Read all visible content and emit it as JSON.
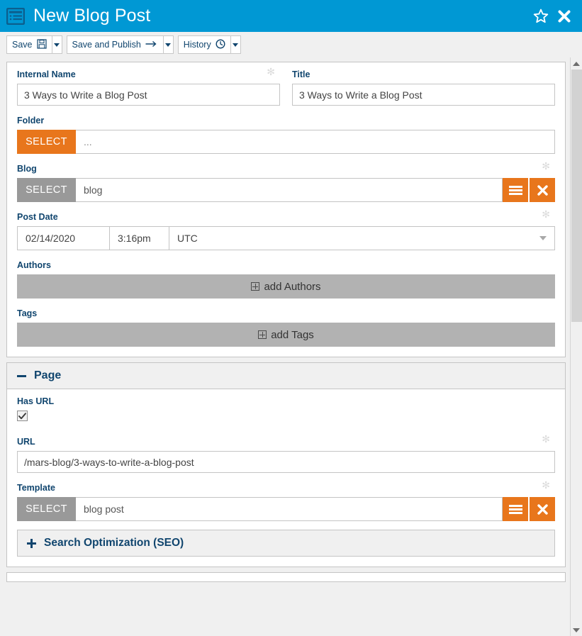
{
  "titlebar": {
    "icon": "list-document-icon",
    "title": "New Blog Post",
    "favorite_icon": "star-icon",
    "close_icon": "close-icon",
    "bg_color": "#0098d4"
  },
  "toolbar": {
    "buttons": [
      {
        "label": "Save",
        "icon": "floppy-disk-icon",
        "has_dropdown": true
      },
      {
        "label": "Save and Publish",
        "icon": "arrow-right-icon",
        "has_dropdown": true
      },
      {
        "label": "History",
        "icon": "clock-icon",
        "has_dropdown": true
      }
    ]
  },
  "panels": [
    {
      "name": "details",
      "fields": {
        "internal_name": {
          "label": "Internal Name",
          "value": "3 Ways to Write a Blog Post",
          "placeholder": "",
          "required_marker": "✻"
        },
        "title": {
          "label": "Title",
          "value": "3 Ways to Write a Blog Post",
          "placeholder": ""
        },
        "folder": {
          "label": "Folder",
          "select_label": "SELECT",
          "select_color": "#e8761c",
          "value": "...",
          "placeholder": "..."
        },
        "blog": {
          "label": "Blog",
          "select_label": "SELECT",
          "select_color": "#999999",
          "value": "blog",
          "placeholder": "",
          "menu_icon": "hamburger-menu-icon",
          "clear_icon": "close-icon",
          "required_marker": "✻"
        },
        "post_date": {
          "label": "Post Date",
          "date": "02/14/2020",
          "time": "3:16pm",
          "timezone": "UTC",
          "required_marker": "✻",
          "dropdown_icon": "chevron-down-icon"
        },
        "authors": {
          "label": "Authors",
          "add_label": "add Authors",
          "add_icon": "plus-box-icon"
        },
        "tags": {
          "label": "Tags",
          "add_label": "add Tags",
          "add_icon": "plus-box-icon"
        }
      }
    },
    {
      "name": "page",
      "header": {
        "title": "Page",
        "toggle_icon": "minus-icon",
        "expanded": true
      },
      "fields": {
        "has_url": {
          "label": "Has URL",
          "checked": true,
          "check_icon": "checkmark-icon"
        },
        "url": {
          "label": "URL",
          "value": "/mars-blog/3-ways-to-write-a-blog-post",
          "placeholder": "",
          "required_marker": "✻"
        },
        "template": {
          "label": "Template",
          "select_label": "SELECT",
          "select_color": "#999999",
          "value": "blog post",
          "placeholder": "",
          "menu_icon": "hamburger-menu-icon",
          "clear_icon": "close-icon",
          "required_marker": "✻"
        },
        "seo": {
          "title": "Search Optimization (SEO)",
          "toggle_icon": "plus-icon",
          "expanded": false
        }
      }
    }
  ],
  "scrollbar": {
    "up_icon": "triangle-up-icon",
    "down_icon": "triangle-down-icon"
  }
}
